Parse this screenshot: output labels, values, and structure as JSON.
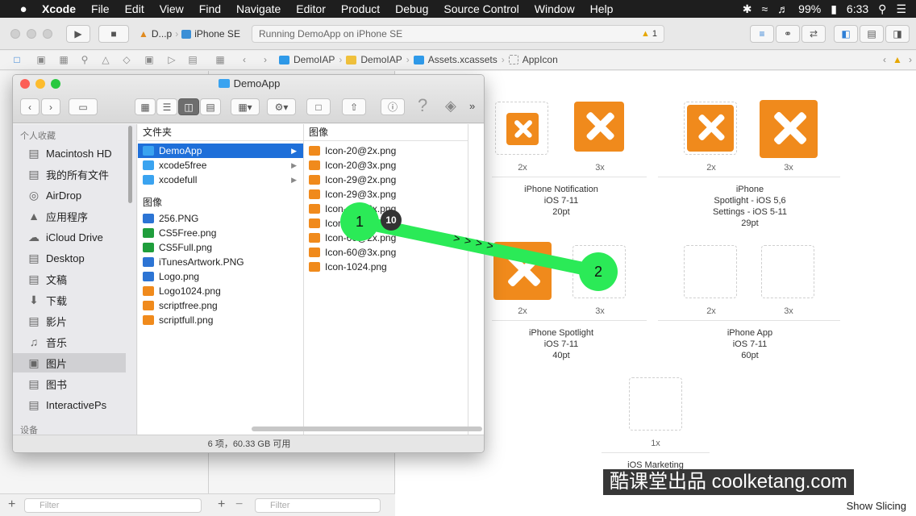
{
  "menubar": {
    "apple": "",
    "items": [
      "Xcode",
      "File",
      "Edit",
      "View",
      "Find",
      "Navigate",
      "Editor",
      "Product",
      "Debug",
      "Source Control",
      "Window",
      "Help"
    ],
    "battery": "99%",
    "time": "6:33"
  },
  "toolbar": {
    "scheme_app": "D...p",
    "scheme_device": "iPhone SE",
    "activity_text": "Running DemoApp on iPhone SE",
    "warning_count": "1"
  },
  "breadcrumb": [
    "DemoIAP",
    "DemoIAP",
    "Assets.xcassets",
    "AppIcon"
  ],
  "asset_catalog": {
    "groups": [
      {
        "caption_lines": [
          "iPhone Notification",
          "iOS 7-11",
          "20pt"
        ],
        "scales": [
          "2x",
          "3x"
        ]
      },
      {
        "caption_lines": [
          "iPhone",
          "Spotlight - iOS 5,6",
          "Settings - iOS 5-11",
          "29pt"
        ],
        "scales": [
          "2x",
          "3x"
        ]
      },
      {
        "caption_lines": [
          "iPhone Spotlight",
          "iOS 7-11",
          "40pt"
        ],
        "scales": [
          "2x",
          "3x"
        ]
      },
      {
        "caption_lines": [
          "iPhone App",
          "iOS 7-11",
          "60pt"
        ],
        "scales": [
          "2x",
          "3x"
        ]
      },
      {
        "caption_lines": [
          "iOS Marketing"
        ],
        "scales": [
          "1x"
        ]
      }
    ],
    "show_slicing": "Show Slicing"
  },
  "filters": {
    "placeholder": "Filter"
  },
  "finder": {
    "title": "DemoApp",
    "favorites_header": "个人收藏",
    "devices_header": "设备",
    "sidebar": [
      {
        "label": "Macintosh HD",
        "icon": "disk-icon"
      },
      {
        "label": "我的所有文件",
        "icon": "all-files-icon"
      },
      {
        "label": "AirDrop",
        "icon": "airdrop-icon"
      },
      {
        "label": "应用程序",
        "icon": "applications-icon"
      },
      {
        "label": "iCloud Drive",
        "icon": "cloud-icon"
      },
      {
        "label": "Desktop",
        "icon": "folder-icon"
      },
      {
        "label": "文稿",
        "icon": "documents-icon"
      },
      {
        "label": "下载",
        "icon": "download-icon"
      },
      {
        "label": "影片",
        "icon": "movies-icon"
      },
      {
        "label": "音乐",
        "icon": "music-icon"
      },
      {
        "label": "图片",
        "icon": "camera-icon"
      },
      {
        "label": "图书",
        "icon": "folder-icon"
      },
      {
        "label": "InteractivePs",
        "icon": "folder-icon"
      }
    ],
    "col1": {
      "folders_header": "文件夹",
      "folders": [
        "DemoApp",
        "xcode5free",
        "xcodefull"
      ],
      "images_header": "图像",
      "images": [
        "256.PNG",
        "CS5Free.png",
        "CS5Full.png",
        "iTunesArtwork.PNG",
        "Logo.png",
        "Logo1024.png",
        "scriptfree.png",
        "scriptfull.png"
      ]
    },
    "col2": {
      "images_header": "图像",
      "images": [
        "Icon-20@2x.png",
        "Icon-20@3x.png",
        "Icon-29@2x.png",
        "Icon-29@3x.png",
        "Icon-40@2x.png",
        "Icon-40@3x.png",
        "Icon-60@2x.png",
        "Icon-60@3x.png",
        "Icon-1024.png"
      ]
    },
    "status": "6 项，60.33 GB 可用"
  },
  "drag_overlay": {
    "start_label": "1",
    "count_badge": "10",
    "arrows": "> > > >",
    "end_label": "2"
  },
  "watermark": "酷课堂出品 coolketang.com",
  "colors": {
    "accent": "#1e6fd9",
    "icon_orange": "#f08a1c",
    "drag_green": "#2bea57"
  }
}
